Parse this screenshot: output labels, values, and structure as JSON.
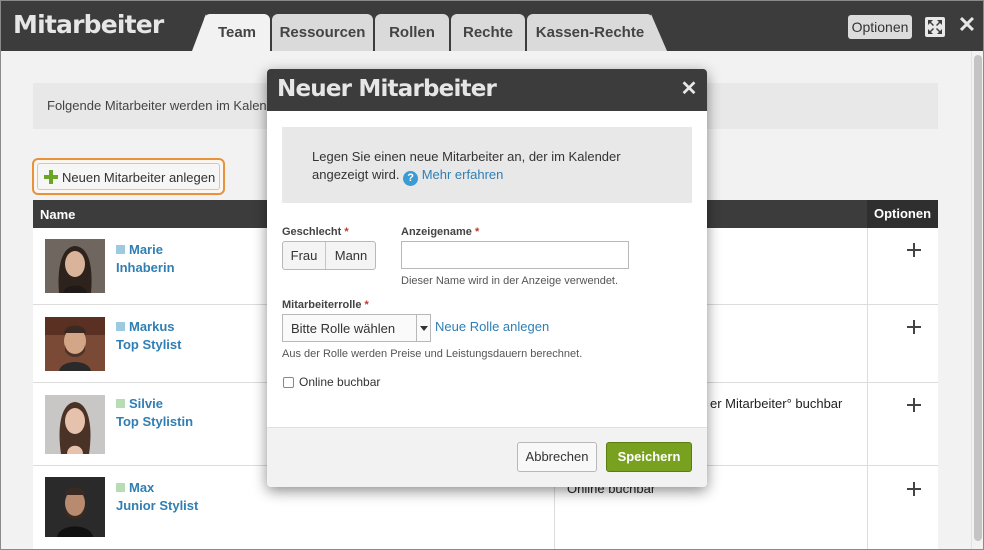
{
  "app": {
    "title": "Mitarbeiter",
    "options_label": "Optionen"
  },
  "tabs": [
    {
      "label": "Team",
      "active": true
    },
    {
      "label": "Ressourcen",
      "active": false
    },
    {
      "label": "Rollen",
      "active": false
    },
    {
      "label": "Rechte",
      "active": false
    },
    {
      "label": "Kassen-Rechte",
      "active": false
    }
  ],
  "main": {
    "info_text": "Folgende Mitarbeiter werden im Kalen",
    "new_employee_button": "Neuen Mitarbeiter anlegen",
    "table": {
      "col_name": "Name",
      "col_options": "Optionen",
      "rows": [
        {
          "name": "Marie",
          "role": "Inhaberin",
          "color": "#9ecae1",
          "extra": ""
        },
        {
          "name": "Markus",
          "role": "Top Stylist",
          "color": "#9ecae1",
          "extra": ""
        },
        {
          "name": "Silvie",
          "role": "Top Stylistin",
          "color": "#b8ddb5",
          "extra": "er Mitarbeiter° buchbar"
        },
        {
          "name": "Max",
          "role": "Junior Stylist",
          "color": "#b8ddb5",
          "extra": "Online buchbar"
        }
      ]
    }
  },
  "modal": {
    "title": "Neuer Mitarbeiter",
    "info_text": "Legen Sie einen neue Mitarbeiter an, der im Kalender angezeigt wird.",
    "learn_more": "Mehr erfahren",
    "gender_label": "Geschlecht",
    "gender_options": [
      "Frau",
      "Mann"
    ],
    "display_name_label": "Anzeigename",
    "display_name_value": "",
    "display_name_hint": "Dieser Name wird in der Anzeige verwendet.",
    "role_label": "Mitarbeiterrolle",
    "role_selected": "Bitte Rolle wählen",
    "new_role_link": "Neue Rolle anlegen",
    "role_hint": "Aus der Rolle werden Preise und Leistungsdauern berechnet.",
    "online_label": "Online buchbar",
    "online_checked": false,
    "cancel_label": "Abbrechen",
    "save_label": "Speichern"
  },
  "colors": {
    "header_bg": "#3c3c3c",
    "link": "#2f7fb4",
    "save_green": "#78a11f",
    "highlight_orange": "#e8923c"
  }
}
